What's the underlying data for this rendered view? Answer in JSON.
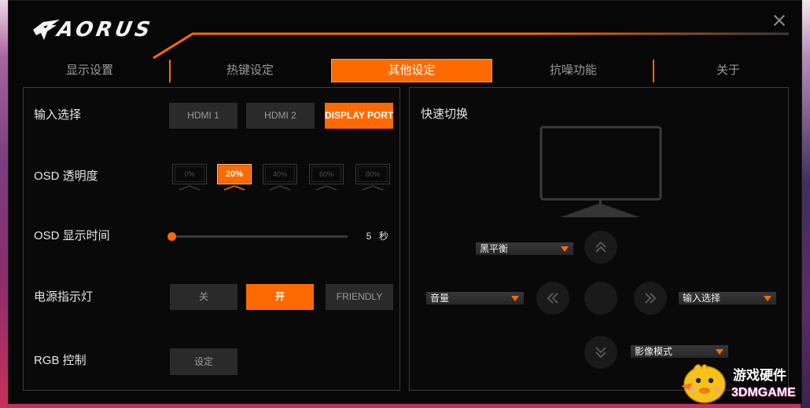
{
  "app": {
    "logo_text": "AORUS",
    "logo_icon": "aorus-falcon-icon",
    "close_icon": "close-icon"
  },
  "tabs": {
    "active_index": 2,
    "items": [
      {
        "label": "显示设置"
      },
      {
        "label": "热键设定"
      },
      {
        "label": "其他设定"
      },
      {
        "label": "抗噪功能"
      },
      {
        "label": "关于"
      }
    ]
  },
  "settings": {
    "input_select": {
      "label": "输入选择",
      "options": [
        "HDMI 1",
        "HDMI 2",
        "DISPLAY PORT"
      ],
      "selected_index": 2
    },
    "osd_transparency": {
      "label": "OSD 透明度",
      "options": [
        "0%",
        "20%",
        "40%",
        "60%",
        "80%"
      ],
      "selected_index": 1
    },
    "osd_display_time": {
      "label": "OSD 显示时间",
      "value": "5",
      "unit": "秒",
      "slider_position": 0
    },
    "power_led": {
      "label": "电源指示灯",
      "options": [
        "关",
        "开",
        "FRIENDLY"
      ],
      "selected_index": 1
    },
    "rgb_control": {
      "label": "RGB 控制",
      "button_label": "设定"
    }
  },
  "quick_switch": {
    "title": "快速切换",
    "monitor_icon": "monitor-icon",
    "up": {
      "icon": "double-chevron-up-icon",
      "value": "黑平衡"
    },
    "left": {
      "icon": "double-chevron-left-icon",
      "value": "音量"
    },
    "right": {
      "icon": "double-chevron-right-icon",
      "value": "输入选择"
    },
    "down": {
      "icon": "double-chevron-down-icon",
      "value": "影像模式"
    }
  },
  "watermark": {
    "icon": "chick-mascot-icon",
    "line1": "游戏硬件",
    "line2": "3DMGAME"
  },
  "colors": {
    "accent": "#ff6a00",
    "panel_border": "#3a3a3a",
    "button_bg": "#2a2a2a",
    "dropdown_bg": "#2e2e2e",
    "window_bg": "#070707"
  }
}
